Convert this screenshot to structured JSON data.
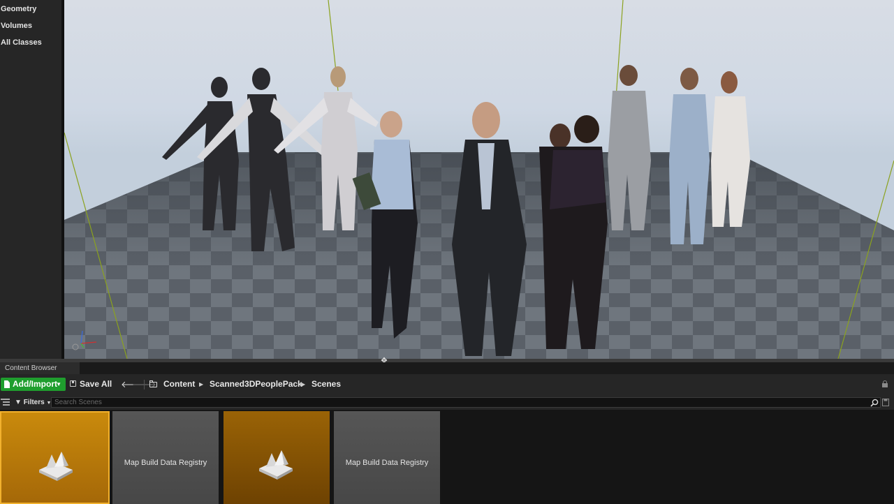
{
  "left_panel": {
    "items": [
      "Geometry",
      "Volumes",
      "All Classes"
    ]
  },
  "content_browser": {
    "tab_label": "Content Browser",
    "toolbar": {
      "add_import_label": "Add/Import",
      "save_all_label": "Save All",
      "breadcrumbs": [
        "Content",
        "Scanned3DPeoplePack",
        "Scenes"
      ]
    },
    "filters_label": "Filters",
    "search_placeholder": "Search Scenes",
    "assets": [
      {
        "type": "map",
        "label": "",
        "selected": true
      },
      {
        "type": "registry",
        "label": "Map Build Data Registry"
      },
      {
        "type": "map",
        "label": "",
        "selected": false
      },
      {
        "type": "registry",
        "label": "Map Build Data Registry"
      }
    ]
  },
  "colors": {
    "accent_green": "#1f9e2e",
    "selection_orange": "#f2b12d",
    "map_tile": "#9a6306",
    "registry_tile": "#565656"
  }
}
